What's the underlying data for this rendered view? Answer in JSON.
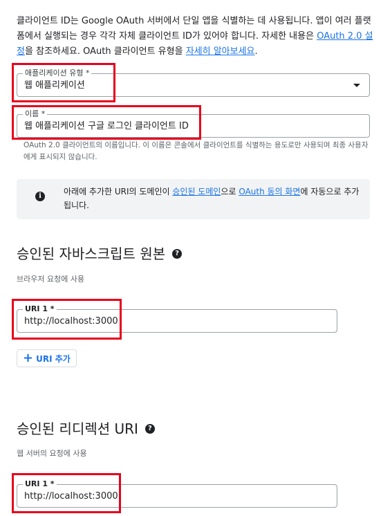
{
  "intro": {
    "text_1": "클라이언트 ID는 Google OAuth 서버에서 단일 앱을 식별하는 데 사용됩니다. 앱이 여러 플랫폼에서 실행되는 경우 각각 자체 클라이언트 ID가 있어야 합니다. 자세한 내용은 ",
    "link_1": "OAuth 2.0 설정",
    "text_2": "을 참조하세요. OAuth 클라이언트 유형을 ",
    "link_2": "자세히 알아보세요",
    "text_3": "."
  },
  "app_type": {
    "label": "애플리케이션 유형 *",
    "value": "웹 애플리케이션"
  },
  "name": {
    "label": "이름 *",
    "value": "웹 애플리케이션 구글 로그인 클라이언트 ID",
    "hint": "OAuth 2.0 클라이언트의 이름입니다. 이 이름은 콘솔에서 클라이언트를 식별하는 용도로만 사용되며 최종 사용자에게 표시되지 않습니다."
  },
  "info": {
    "text_1": "아래에 추가한 URI의 도메인이 ",
    "link_1": "승인된 도메인",
    "text_2": "으로 ",
    "link_2": "OAuth 동의 화면",
    "text_3": "에 자동으로 추가됩니다."
  },
  "js_origins": {
    "title": "승인된 자바스크립트 원본",
    "subtitle": "브라우저 요청에 사용",
    "uri_label": "URI 1 *",
    "uri_value": "http://localhost:3000",
    "add_button": "URI 추가"
  },
  "redirect_uris": {
    "title": "승인된 리디렉션 URI",
    "subtitle": "웹 서버의 요청에 사용",
    "uri_label": "URI 1 *",
    "uri_value": "http://localhost:3000"
  },
  "icons": {
    "info": "info-icon",
    "help": "help-icon",
    "dropdown": "dropdown-caret-icon",
    "add": "plus-icon"
  },
  "colors": {
    "link": "#1a73e8",
    "highlight": "#e8001c",
    "info_bg": "#f1f3f4"
  }
}
